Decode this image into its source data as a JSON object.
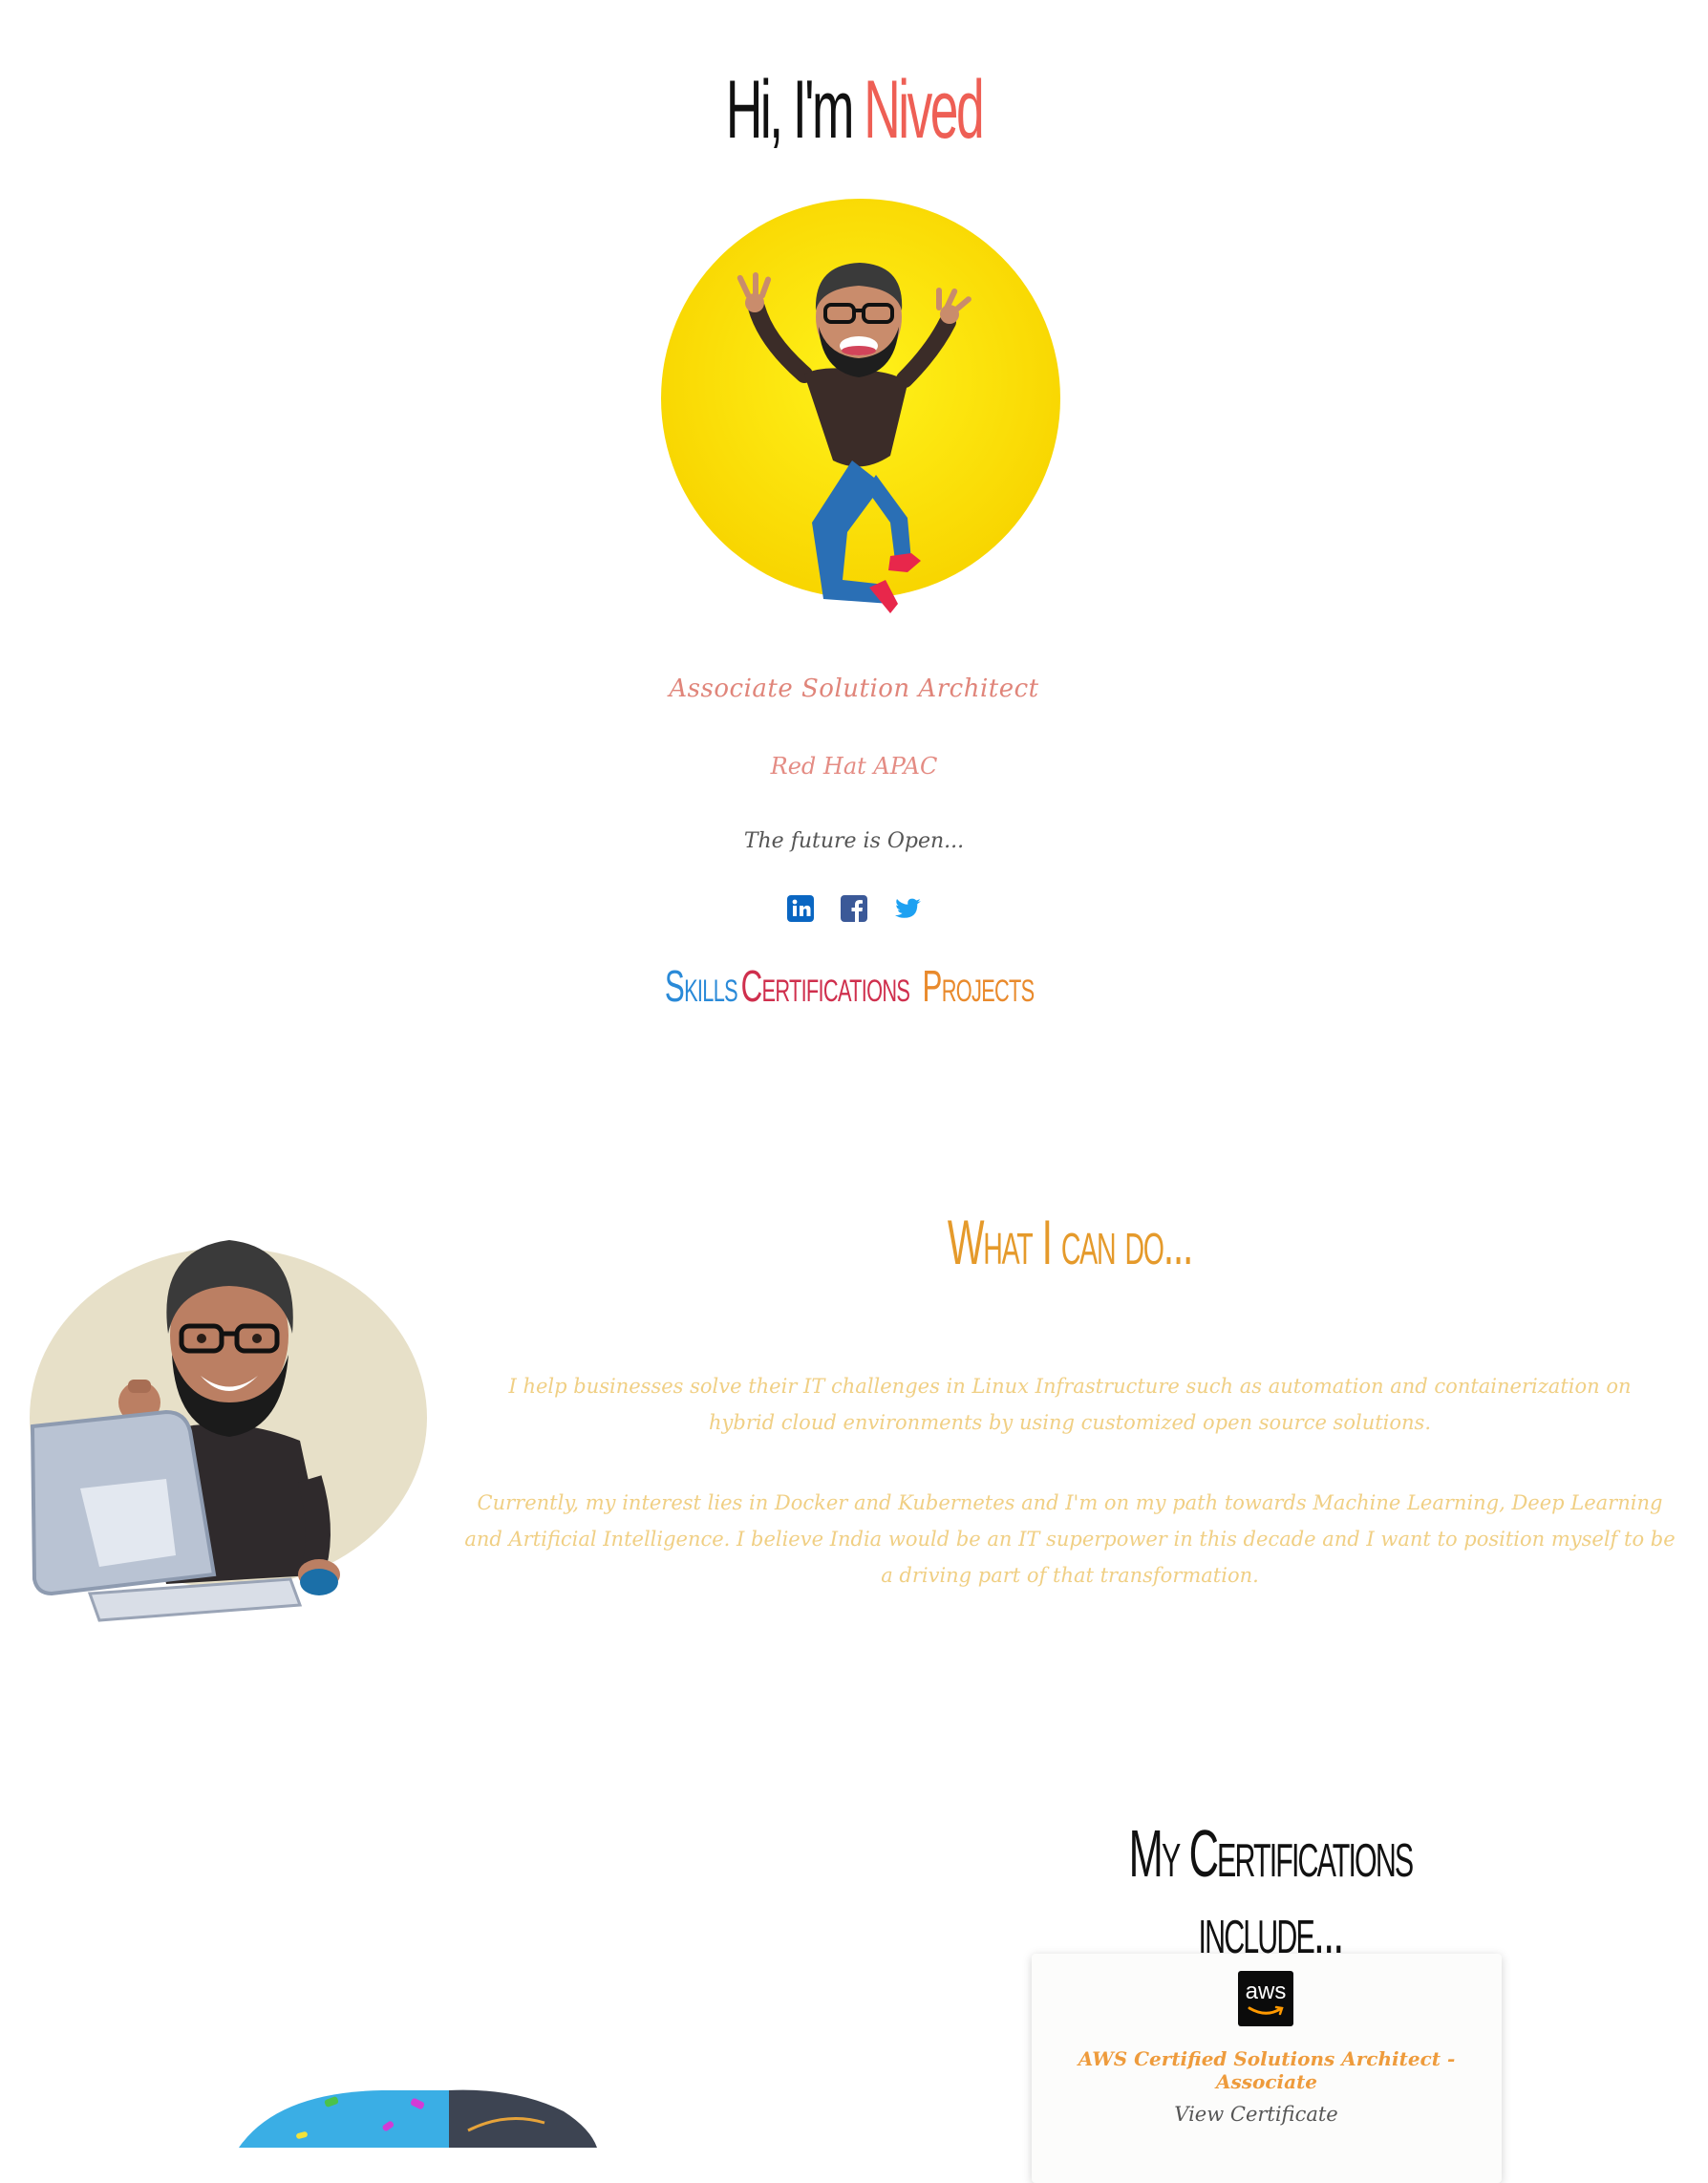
{
  "hero": {
    "title_prefix": "Hi, I'm",
    "title_name": "Nived",
    "role": "Associate Solution Architect",
    "company": "Red Hat APAC",
    "tagline": "The future is Open...",
    "avatar_icon": "waving-person-avatar-icon"
  },
  "social": [
    {
      "name": "linkedin",
      "icon": "linkedin-icon",
      "color": "#0a66c2"
    },
    {
      "name": "facebook",
      "icon": "facebook-icon",
      "color": "#3b5998"
    },
    {
      "name": "twitter",
      "icon": "twitter-icon",
      "color": "#1da1f2"
    }
  ],
  "nav": {
    "skills": "Skills",
    "certifications": "Certifications",
    "projects": "Projects"
  },
  "about": {
    "title": "What I can do...",
    "paragraph1": "I help businesses solve their IT challenges in Linux Infrastructure such as automation and containerization on hybrid cloud environments by using customized open source solutions.",
    "paragraph2": "Currently, my interest lies in Docker and Kubernetes and I'm on my path towards Machine Learning, Deep Learning and Artificial Intelligence. I believe India would be an IT superpower in this decade and I want to position myself to be a driving part of that transformation."
  },
  "certifications": {
    "title": "My Certifications include...",
    "items": [
      {
        "logo_text": "aws",
        "name": "AWS Certified Solutions Architect - Associate",
        "link_label": "View Certificate"
      }
    ]
  },
  "colors": {
    "accent_red": "#ee5f55",
    "skills_blue": "#2a8ad8",
    "certs_red": "#cf2f4d",
    "projects_orange": "#e98a2c",
    "about_title": "#e59a2b",
    "about_text": "#f0cf84"
  }
}
